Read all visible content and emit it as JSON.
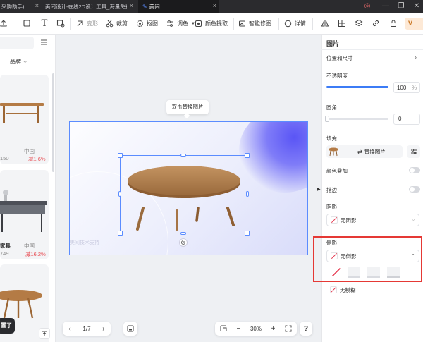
{
  "tabs": [
    {
      "label": "采购助手)",
      "active": false
    },
    {
      "label": "美间设计-在线2D设计工具_海量免费",
      "active": false
    },
    {
      "label": "美间",
      "active": true
    }
  ],
  "toolbar": {
    "items": [
      {
        "label": "变形",
        "icon": "transform-icon"
      },
      {
        "label": "裁剪",
        "icon": "crop-icon"
      },
      {
        "label": "抠图",
        "icon": "cutout-icon"
      },
      {
        "label": "调色",
        "icon": "adjust-icon"
      },
      {
        "label": "颜色提取",
        "icon": "color-picker-icon"
      },
      {
        "label": "智能修图",
        "icon": "smart-retouch-icon"
      },
      {
        "label": "详情",
        "icon": "info-icon"
      }
    ],
    "vip_label": "V"
  },
  "left_panel": {
    "filter_label": "品牌",
    "products": [
      {
        "origin": "中国",
        "price": "150",
        "discount": "减1.6%"
      },
      {
        "name": "家具",
        "origin": "中国",
        "price": "749",
        "discount": "减16.2%"
      },
      {
        "name": "",
        "origin": "",
        "price": "",
        "discount": ""
      }
    ],
    "bottom_tag": "置了"
  },
  "canvas": {
    "tooltip": "双击替换图片",
    "watermark": "美间技术支持"
  },
  "bottom_bar": {
    "page": "1/7",
    "zoom": "30%",
    "help": "?"
  },
  "right_panel": {
    "title": "图片",
    "position_size": "位置和尺寸",
    "opacity": {
      "label": "不透明度",
      "value": "100",
      "unit": "%",
      "level": 1.0
    },
    "corner": {
      "label": "圆角",
      "value": "0",
      "level": 0.0
    },
    "fill": {
      "label": "填充",
      "replace_label": "替换图片"
    },
    "color_overlay": {
      "label": "颜色叠加",
      "on": false
    },
    "stroke": {
      "label": "描边",
      "on": false
    },
    "shadow": {
      "label": "阴影",
      "value": "无阴影"
    },
    "reflection": {
      "label": "倒影",
      "value": "无倒影",
      "options": [
        "none",
        "r1",
        "r2",
        "r3"
      ]
    },
    "blur": {
      "value": "无模糊"
    }
  },
  "colors": {
    "accent": "#5b8cff",
    "highlight": "#e53935",
    "discount": "#e8494f"
  }
}
